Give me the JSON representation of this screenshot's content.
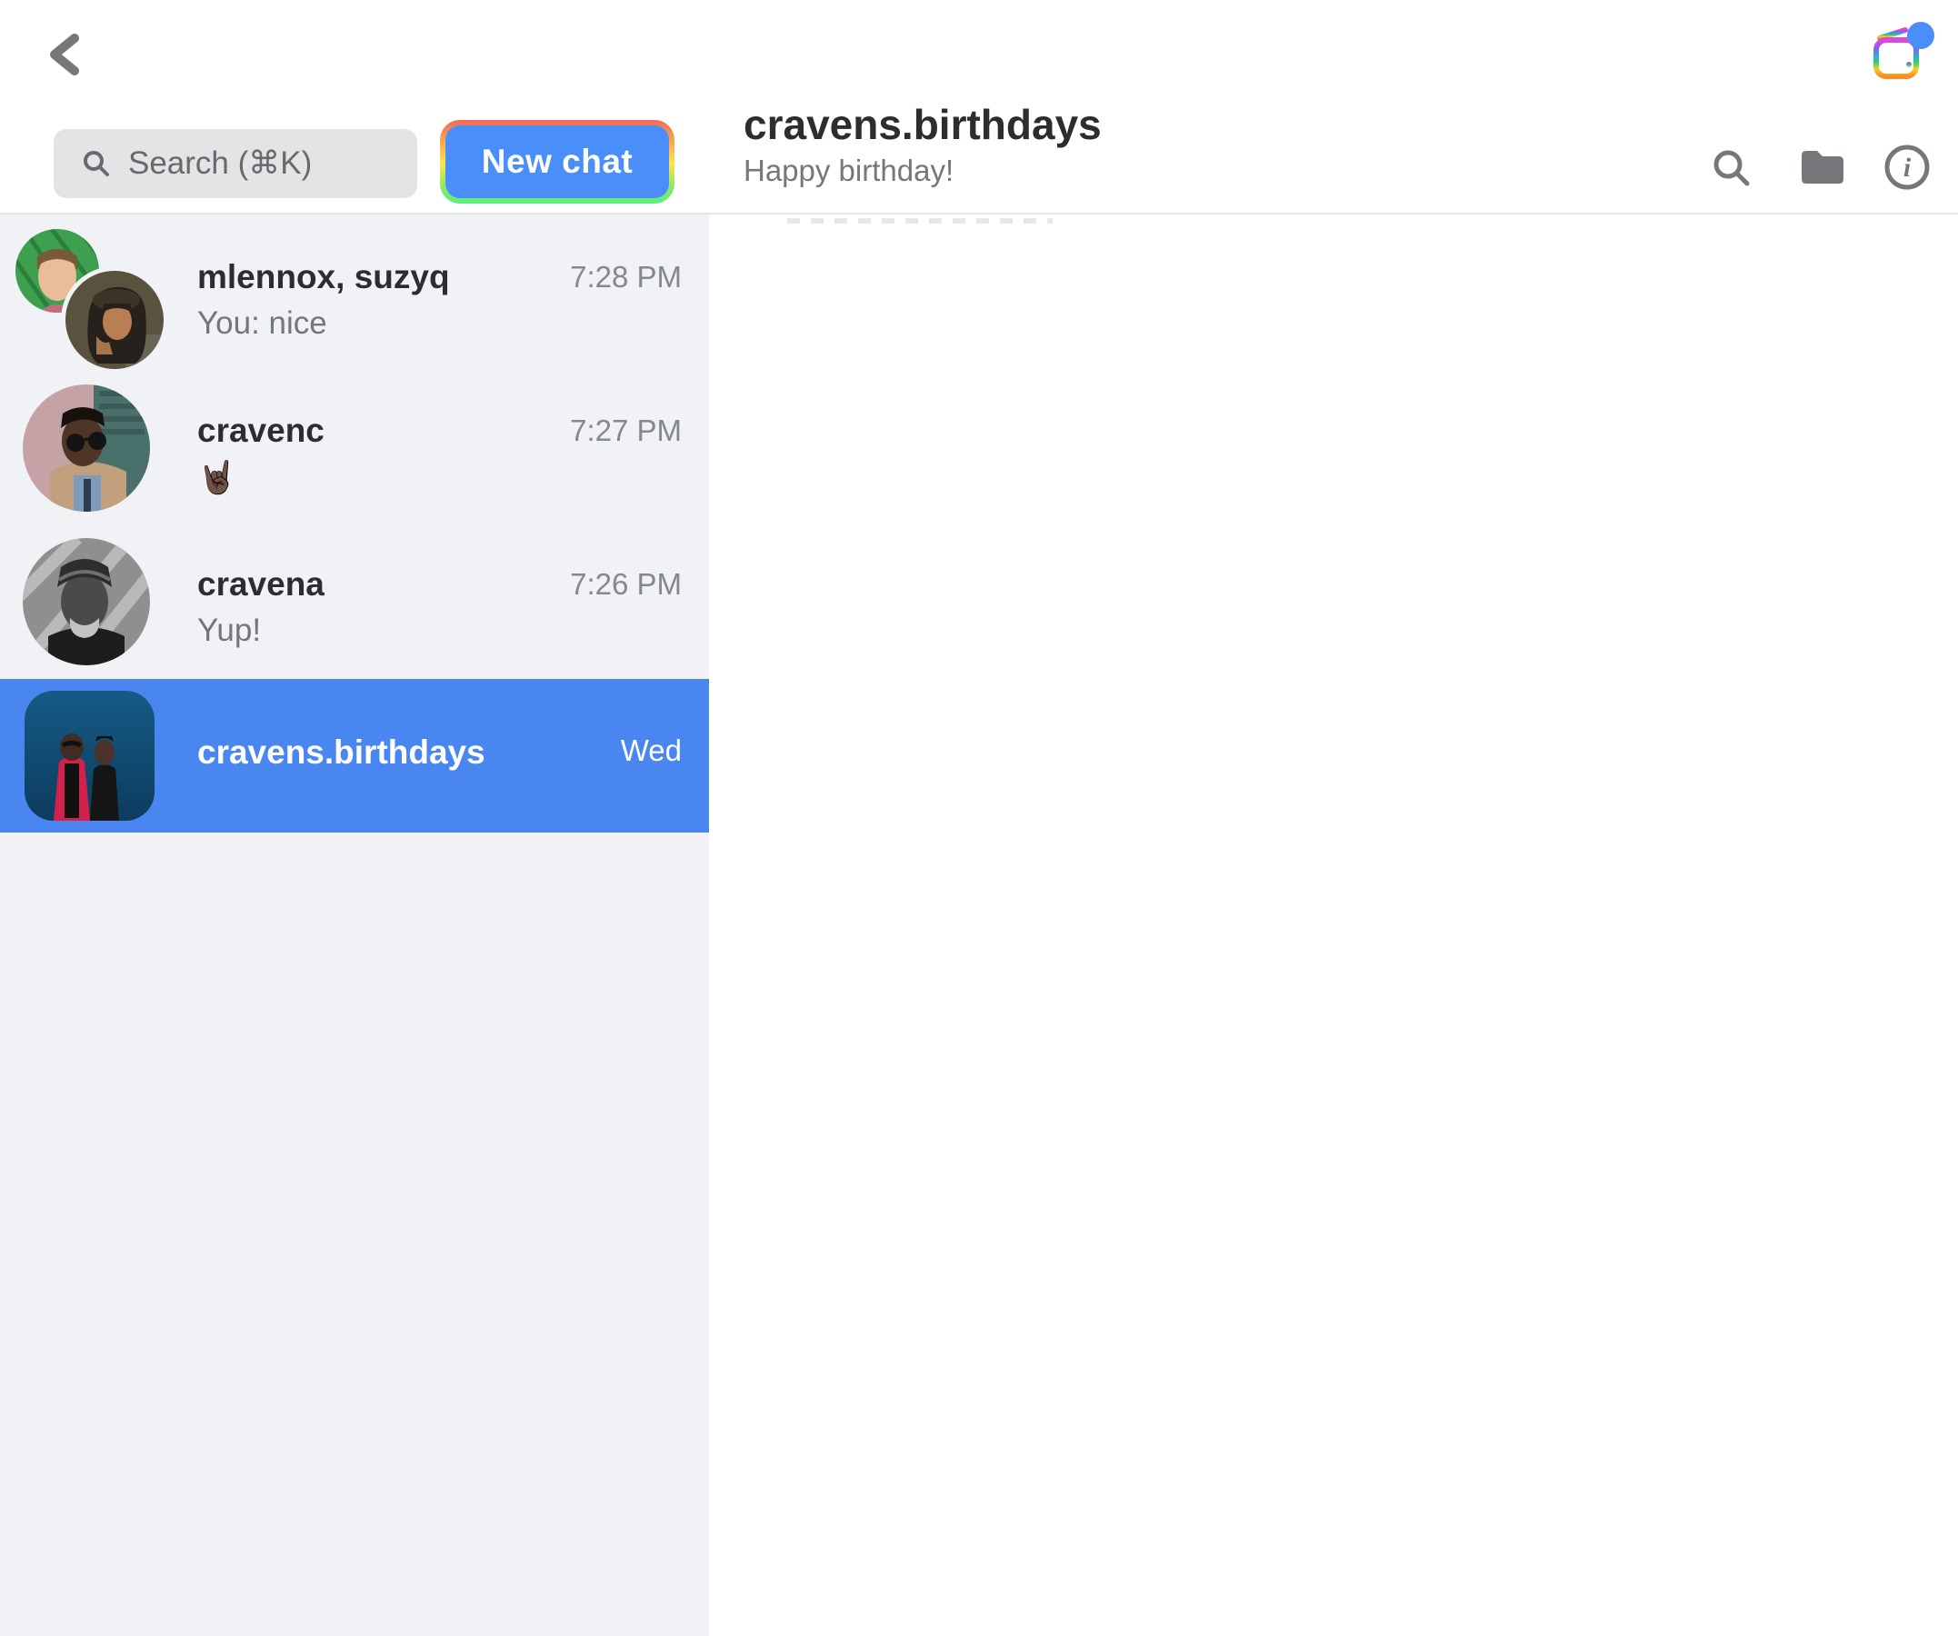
{
  "header": {
    "search_placeholder": "Search (⌘K)",
    "new_chat_label": "New chat",
    "conversation_title": "cravens.birthdays",
    "conversation_subtitle": "Happy birthday!"
  },
  "icons": {
    "back": "chevron-left",
    "app_badge": "rainbow-radio with blue notification dot",
    "search_field": "magnifier",
    "toolbar": [
      "search-magnifier",
      "folder",
      "info-circle"
    ]
  },
  "chat_list": [
    {
      "name": "mlennox, suzyq",
      "time": "7:28 PM",
      "preview": "You: nice",
      "selected": false,
      "avatar": "two-women-group"
    },
    {
      "name": "cravenc",
      "time": "7:27 PM",
      "preview": "🤘🏿",
      "selected": false,
      "avatar": "man-sunglasses-tan-coat"
    },
    {
      "name": "cravena",
      "time": "7:26 PM",
      "preview": "Yup!",
      "selected": false,
      "avatar": "bw-man-beanie"
    },
    {
      "name": "cravens.birthdays",
      "time": "Wed",
      "preview": "",
      "selected": true,
      "avatar": "two-men-red-suit-blue"
    }
  ],
  "colors": {
    "selected_row_blue": "#4a86f0",
    "new_chat_blue": "#4a8ff9",
    "badge_blue": "#4a8ef8",
    "sidebar_bg": "#f0f2f5",
    "gradient_border": [
      "#f4685c",
      "#ffe44e",
      "#5cef7e"
    ]
  }
}
